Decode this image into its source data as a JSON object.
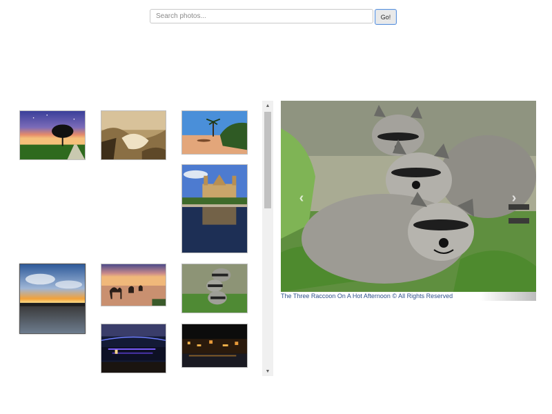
{
  "search": {
    "placeholder": "Search photos...",
    "value": "",
    "button_label": "Go!"
  },
  "gallery": {
    "thumbnails": [
      {
        "subject": "tree-at-dusk"
      },
      {
        "subject": "sepia-waves"
      },
      {
        "subject": "desert-palms"
      },
      {
        "subject": "church-reflection"
      },
      {
        "subject": "sunset-reflection"
      },
      {
        "subject": "camel-caravan"
      },
      {
        "subject": "raccoons"
      },
      {
        "subject": "bridge-night"
      },
      {
        "subject": "harbor-night"
      }
    ]
  },
  "viewer": {
    "subject": "three-raccoons",
    "prev_icon": "chevron-left-icon",
    "next_icon": "chevron-right-icon",
    "prev_glyph": "‹",
    "next_glyph": "›",
    "caption": "The Three Raccoon On A Hot Afternoon © All Rights Reserved"
  },
  "scrollbar": {
    "up_glyph": "▲",
    "down_glyph": "▼"
  }
}
